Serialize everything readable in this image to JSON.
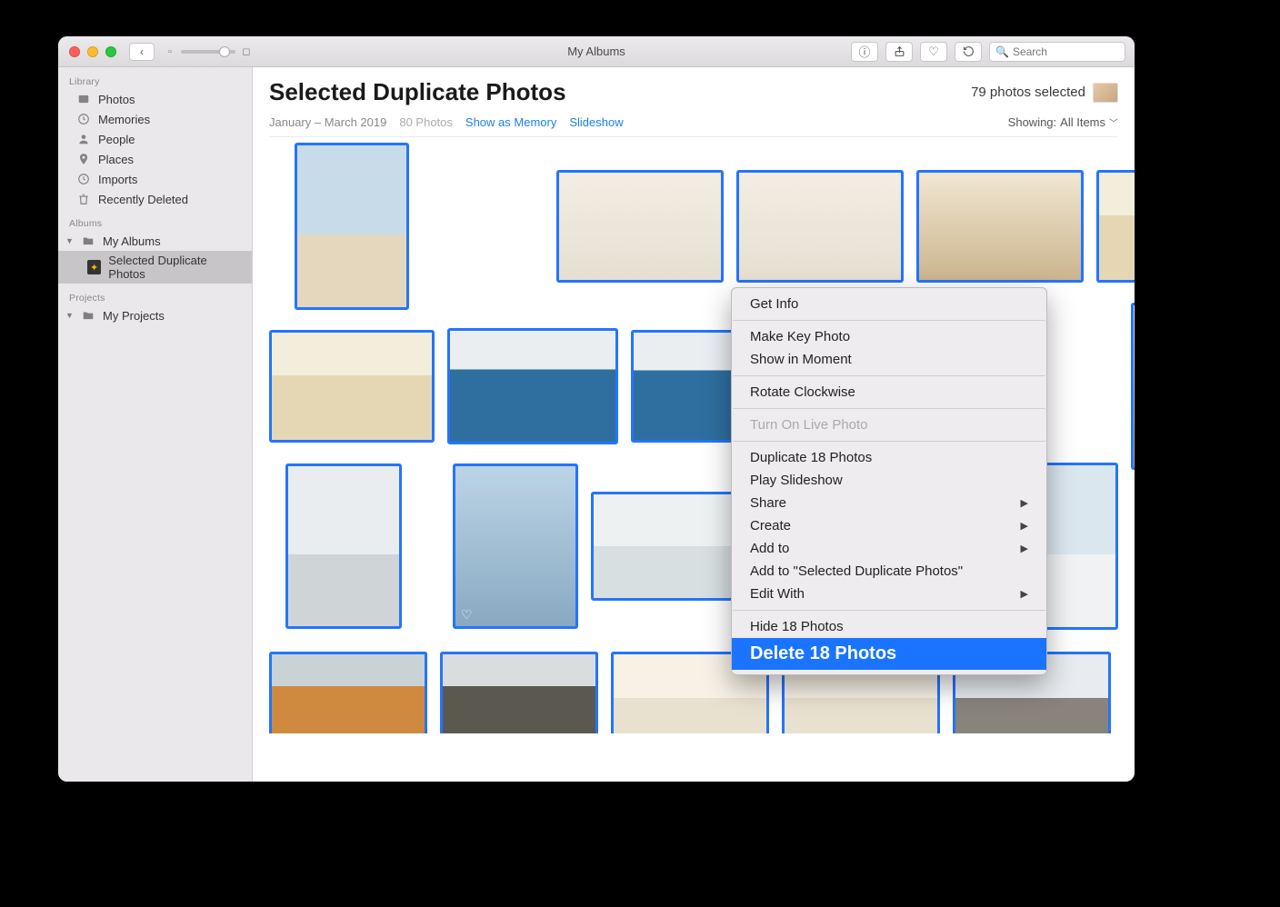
{
  "window": {
    "title": "My Albums"
  },
  "toolbar": {
    "search_placeholder": "Search"
  },
  "sidebar": {
    "headings": {
      "library": "Library",
      "albums": "Albums",
      "projects": "Projects"
    },
    "library": [
      {
        "label": "Photos"
      },
      {
        "label": "Memories"
      },
      {
        "label": "People"
      },
      {
        "label": "Places"
      },
      {
        "label": "Imports"
      },
      {
        "label": "Recently Deleted"
      }
    ],
    "albums": [
      {
        "label": "My Albums"
      },
      {
        "label": "Selected Duplicate Photos"
      }
    ],
    "projects": [
      {
        "label": "My Projects"
      }
    ]
  },
  "header": {
    "title": "Selected Duplicate Photos",
    "selected_text": "79 photos selected",
    "date_range": "January – March 2019",
    "count": "80 Photos",
    "show_memory": "Show as Memory",
    "slideshow": "Slideshow",
    "showing_label": "Showing:",
    "showing_value": "All Items"
  },
  "context_menu": {
    "get_info": "Get Info",
    "make_key": "Make Key Photo",
    "show_moment": "Show in Moment",
    "rotate": "Rotate Clockwise",
    "live_photo": "Turn On Live Photo",
    "duplicate": "Duplicate 18 Photos",
    "play_slideshow": "Play Slideshow",
    "share": "Share",
    "create": "Create",
    "add_to": "Add to",
    "add_to_album": "Add to \"Selected Duplicate Photos\"",
    "edit_with": "Edit With",
    "hide": "Hide 18 Photos",
    "delete": "Delete 18 Photos"
  }
}
